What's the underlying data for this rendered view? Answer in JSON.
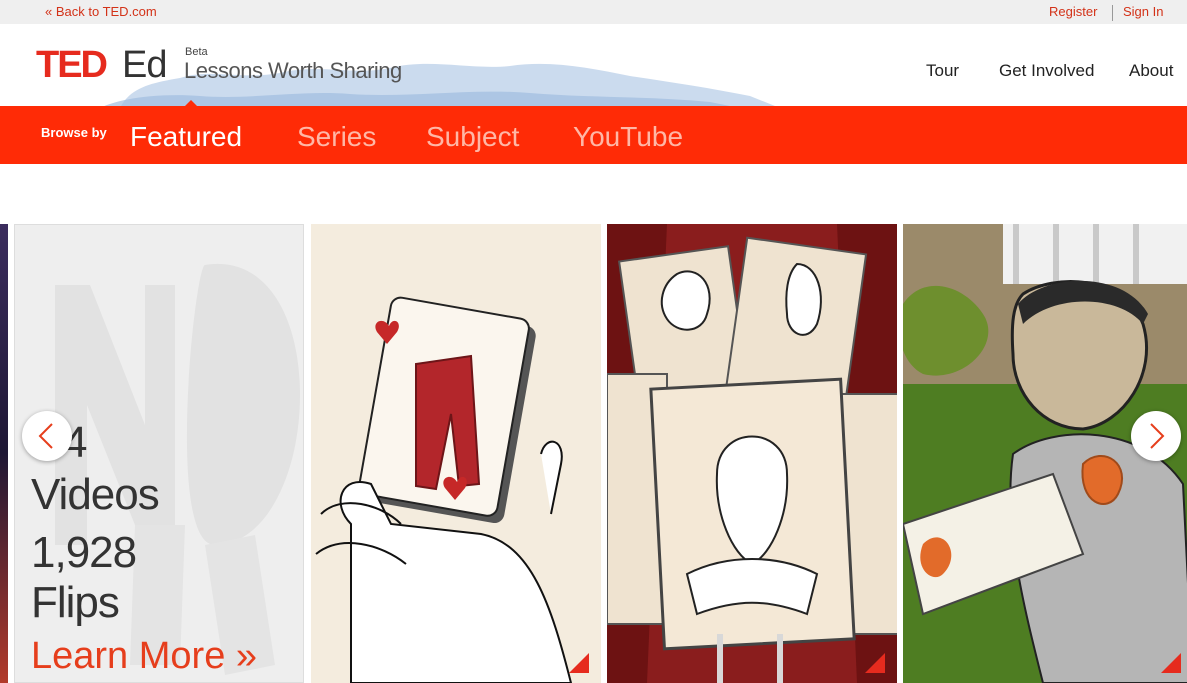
{
  "topbar": {
    "back_link": "« Back to TED.com",
    "register": "Register",
    "sign_in": "Sign In"
  },
  "header": {
    "logo_ted": "TED",
    "logo_ed": "Ed",
    "beta": "Beta",
    "tagline": "Lessons Worth Sharing",
    "nav": [
      "Tour",
      "Get Involved",
      "About"
    ]
  },
  "browse": {
    "label": "Browse by",
    "tabs": [
      "Featured",
      "Series",
      "Subject",
      "YouTube"
    ],
    "active": "Featured"
  },
  "stats": {
    "videos_count_partial": "4",
    "videos_label": "Videos",
    "flips_count": "1,928",
    "flips_label": "Flips",
    "learn_more": "Learn More »"
  },
  "carousel": {
    "prev_icon": "chevron-left-icon",
    "next_icon": "chevron-right-icon"
  },
  "colors": {
    "brand_red": "#e62b1e",
    "browse_bar": "#ff2b06",
    "link_red": "#d33218"
  }
}
